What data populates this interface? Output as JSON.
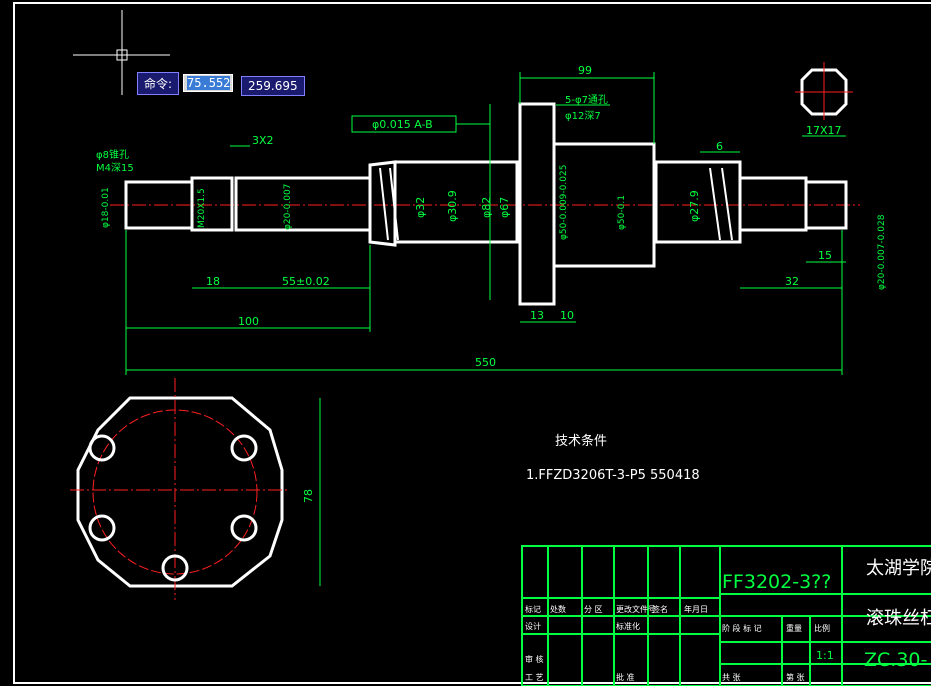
{
  "command": {
    "label": "命令:",
    "x_value": "75.552",
    "y_value": "259.695"
  },
  "dims": {
    "d99": "99",
    "d3x2": "3X2",
    "d6": "6",
    "d18": "18",
    "d55": "55±0.02",
    "d100": "100",
    "d550": "550",
    "d13": "13",
    "d10": "10",
    "d32": "32",
    "d15": "15",
    "d78": "78",
    "d17x17": "17X17",
    "phi32": "φ32",
    "phi309": "φ30.9",
    "phi82": "φ82",
    "phi67": "φ67",
    "phi50a": "φ50-0.009-0.025",
    "phi50b": "φ50-0.1",
    "phi279": "φ27.9",
    "phi20": "φ20-0.007",
    "phi20r": "φ20-0.007-0.028",
    "phi18": "φ18-0.01",
    "m20": "M20X1.5",
    "phi8": "φ8锥孔",
    "m4": "M4深15",
    "holes": "5-φ7通孔",
    "cbore": "φ12深7",
    "tol": "φ0.015 A-B"
  },
  "tech": {
    "title": "技术条件",
    "line1": "1.FFZD3206T-3-P5 550418"
  },
  "titleblock": {
    "code": "FF3202-3??",
    "school": "太湖学院",
    "name": "滚珠丝杠",
    "drawing_no": "ZC.30-",
    "scale": "1:1",
    "h1": "标记",
    "h2": "处数",
    "h3": "分 区",
    "h4": "更改文件号",
    "h5": "签名",
    "h6": "年月日",
    "h7": "设计",
    "h8": "标准化",
    "h9": "阶 段 标 记",
    "h10": "重量",
    "h11": "比例",
    "h12": "审 核",
    "h13": "工 艺",
    "h14": "批 准",
    "h15": "共 张",
    "h16": "第 张"
  },
  "colors": {
    "line": "#ffffff",
    "dim": "#00ff40",
    "center": "#ff2020",
    "frame": "#00ff40"
  }
}
